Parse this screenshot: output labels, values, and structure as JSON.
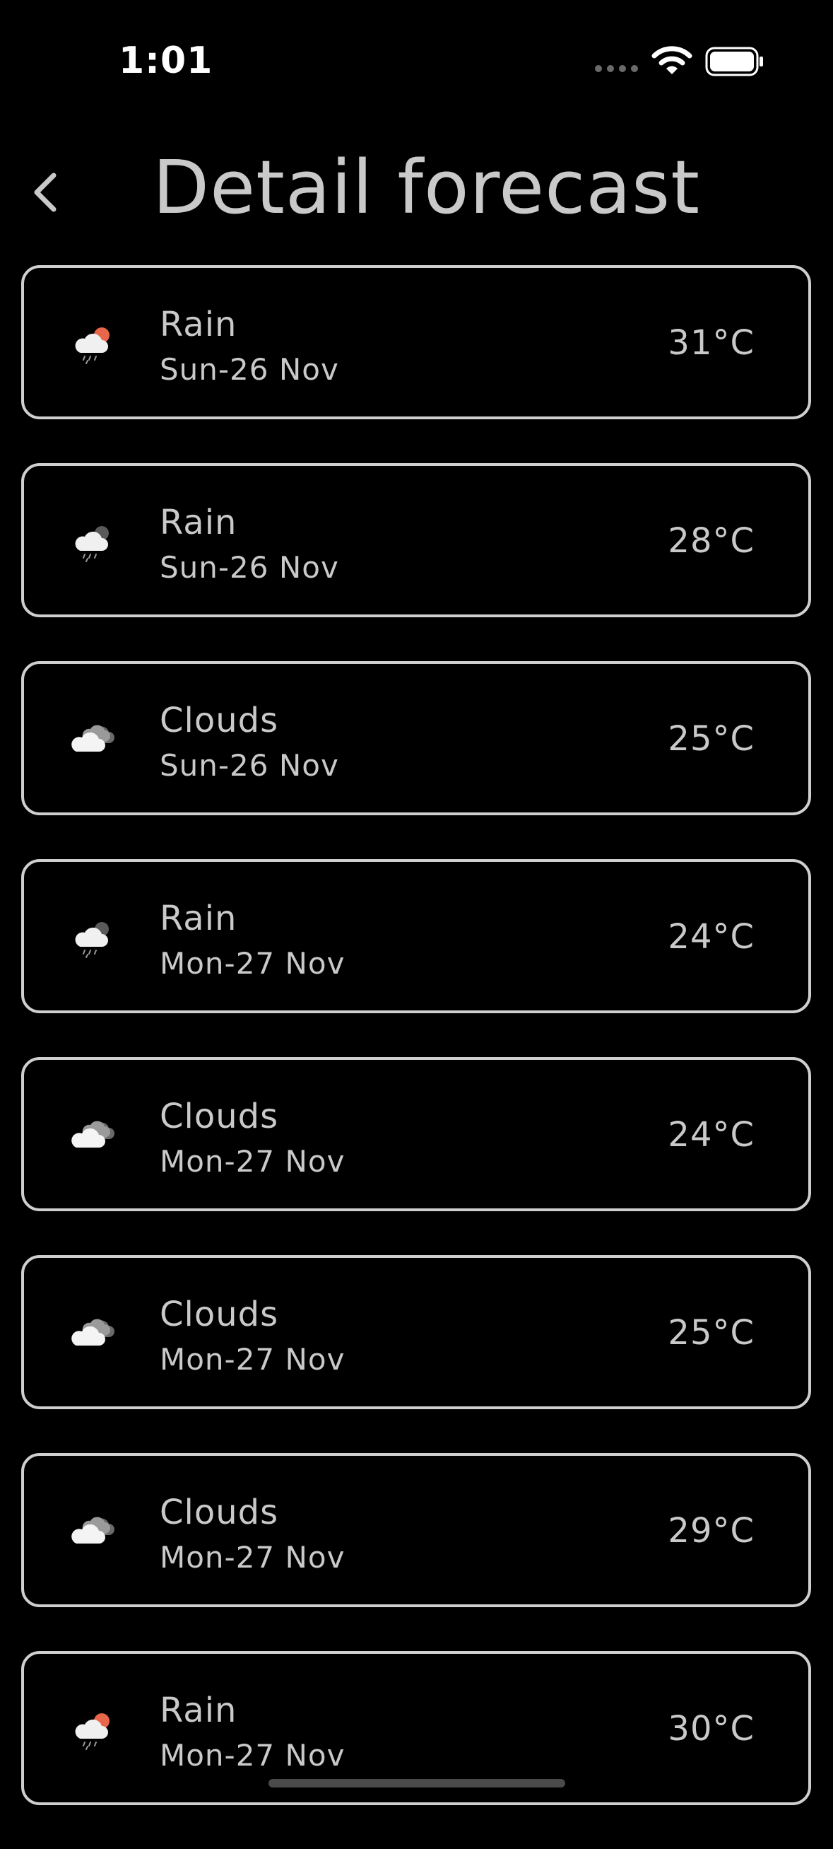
{
  "status_bar": {
    "time": "1:01",
    "icons": [
      "signal-dots-icon",
      "wifi-icon",
      "battery-icon"
    ]
  },
  "header": {
    "back_icon": "chevron-left-icon",
    "title": "Detail forecast"
  },
  "forecasts": [
    {
      "condition": "Rain",
      "date": "Sun-26 Nov",
      "temp": "31°C",
      "icon": "rain-day-icon"
    },
    {
      "condition": "Rain",
      "date": "Sun-26 Nov",
      "temp": "28°C",
      "icon": "rain-night-icon"
    },
    {
      "condition": "Clouds",
      "date": "Sun-26 Nov",
      "temp": "25°C",
      "icon": "clouds-icon"
    },
    {
      "condition": "Rain",
      "date": "Mon-27 Nov",
      "temp": "24°C",
      "icon": "rain-night-icon"
    },
    {
      "condition": "Clouds",
      "date": "Mon-27 Nov",
      "temp": "24°C",
      "icon": "clouds-icon"
    },
    {
      "condition": "Clouds",
      "date": "Mon-27 Nov",
      "temp": "25°C",
      "icon": "clouds-icon"
    },
    {
      "condition": "Clouds",
      "date": "Mon-27 Nov",
      "temp": "29°C",
      "icon": "clouds-icon"
    },
    {
      "condition": "Rain",
      "date": "Mon-27 Nov",
      "temp": "30°C",
      "icon": "rain-day-icon"
    }
  ],
  "colors": {
    "background": "#000000",
    "text": "#c9c9c9",
    "card_border": "#cfcfcf",
    "sun_accent": "#e8674a"
  }
}
